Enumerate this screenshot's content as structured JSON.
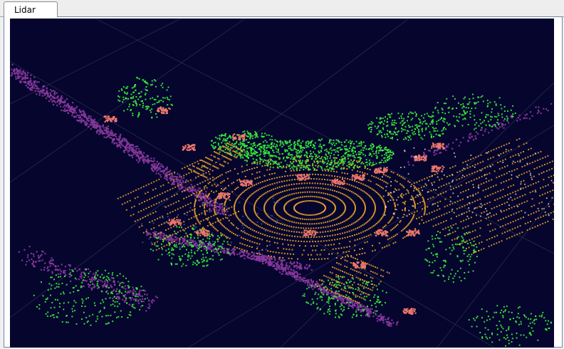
{
  "tabs": [
    {
      "label": "Lidar",
      "active": true
    }
  ],
  "colors": {
    "background": "#05052e",
    "ground_rings": "#e8a02a",
    "vegetation": "#3cf23c",
    "buildings": "#8a3a9e",
    "vehicles": "#f0786e",
    "grid": "#4a4a6e",
    "white_points": "#e8e8e8",
    "blue_points": "#3a5ce0"
  },
  "view": {
    "type": "point-cloud",
    "grid": true,
    "scene": "intersection"
  }
}
